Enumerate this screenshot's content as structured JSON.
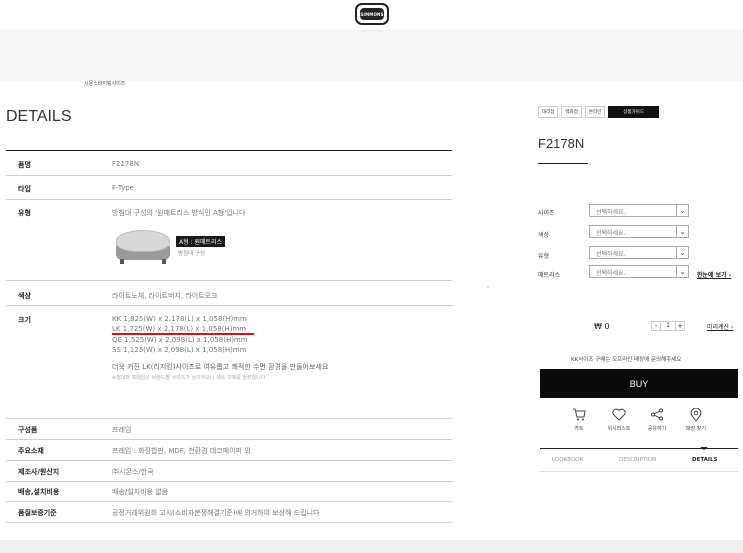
{
  "brand": {
    "logo_text": "SIMMONS"
  },
  "breadcrumb": "시몬스바지링사이즈",
  "details": {
    "title": "DETAILS",
    "rows": {
      "name": {
        "label": "품명",
        "value": "F2178N"
      },
      "type": {
        "label": "타입",
        "value": "F-Type"
      },
      "kind": {
        "label": "유형",
        "value": "방침대 구성의 '원매트리스 방식인 A형'입니다",
        "badge": "A형 : 원매트리스",
        "badge_sub": "방침대 구성"
      },
      "color": {
        "label": "색상",
        "value": "라이트노체, 라이트버지, 라이트오크"
      },
      "size": {
        "label": "크기",
        "lines": [
          "KK 1,825(W) x 2,178(L) x 1,058(H)mm",
          "LK 1,725(W) x 2,178(L) x 1,058(H)mm",
          "QE 1,525(W) x 2,098(L) x 1,058(H)mm",
          "SS 1,125(W) x 2,098(L) x 1,058(H)mm"
        ],
        "desc": "더욱 커진 LK(리지킹)사이즈로 여유롭고 쾌적한 수면 환경을 만들어보세요",
        "note": "※침대와 프레임은 브랜드별 사이즈가 상이하오니 세트 구매를 권장합니다"
      },
      "components": {
        "label": "구성품",
        "value": "프레임"
      },
      "material": {
        "label": "주요소재",
        "value": "프레임 : 화장합판, MDF, 천환경 데코페이퍼 외"
      },
      "maker": {
        "label": "제조사/원산지",
        "value": "㈜시몬스/한국"
      },
      "delivery": {
        "label": "배송,설치비용",
        "value": "배송/설치비용 없음"
      },
      "warranty": {
        "label": "품질보증기준",
        "value": "공정거래위원회 고시(소비자분쟁해결기준)에 의거하여 보상해 드립니다"
      }
    }
  },
  "right": {
    "store_tabs": [
      "대리점",
      "백화점",
      "온라인",
      "상품가이드"
    ],
    "product_code": "F2178N",
    "options": [
      {
        "label": "사이즈",
        "placeholder": "선택하세요."
      },
      {
        "label": "색상",
        "placeholder": "선택하세요."
      },
      {
        "label": "유형",
        "placeholder": "선택하세요."
      },
      {
        "label": "매트리스",
        "placeholder": "선택하세요."
      }
    ],
    "see_more": "한눈에 보기 ›",
    "price": "₩ 0",
    "qty": {
      "minus": "-",
      "value": "1",
      "plus": "+"
    },
    "pre_calc": "미리계산 ›",
    "inquiry": "KK사이즈 구매는 오프라인 매장에 문의해주세요",
    "buy": "BUY",
    "actions": [
      {
        "icon": "cart-icon",
        "label": "카트"
      },
      {
        "icon": "heart-icon",
        "label": "위시리스트"
      },
      {
        "icon": "share-icon",
        "label": "공유하기"
      },
      {
        "icon": "location-pin-icon",
        "label": "매장 찾기"
      }
    ],
    "bottom_tabs": [
      "LOOKBOOK",
      "DESCRIPTION",
      "DETAILS"
    ]
  }
}
